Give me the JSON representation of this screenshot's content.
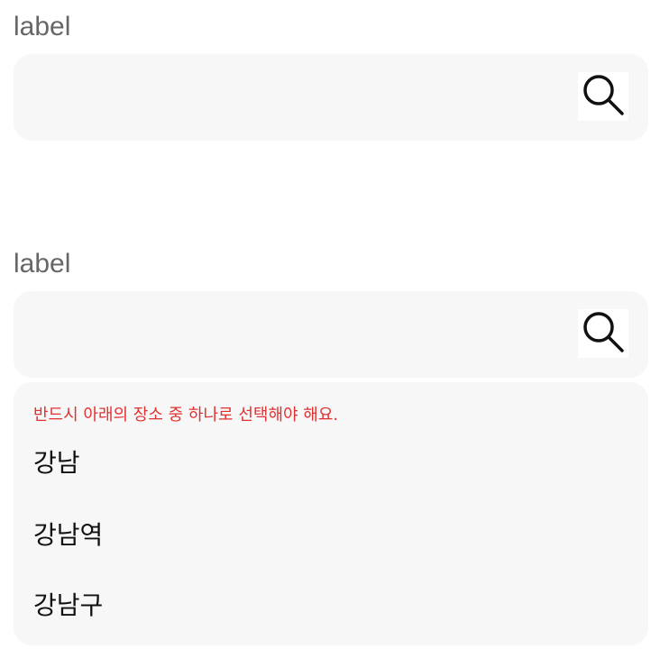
{
  "fields": [
    {
      "label": "label",
      "value": "",
      "placeholder": ""
    },
    {
      "label": "label",
      "value": "",
      "placeholder": ""
    }
  ],
  "search_icon": "search-icon",
  "dropdown": {
    "warning": "반드시 아래의 장소 중 하나로 선택해야 해요.",
    "options": [
      "강남",
      "강남역",
      "강남구"
    ]
  },
  "colors": {
    "field_background": "#f7f7f7",
    "label_text": "#666666",
    "warning_text": "#e03131",
    "option_text": "#111111"
  }
}
